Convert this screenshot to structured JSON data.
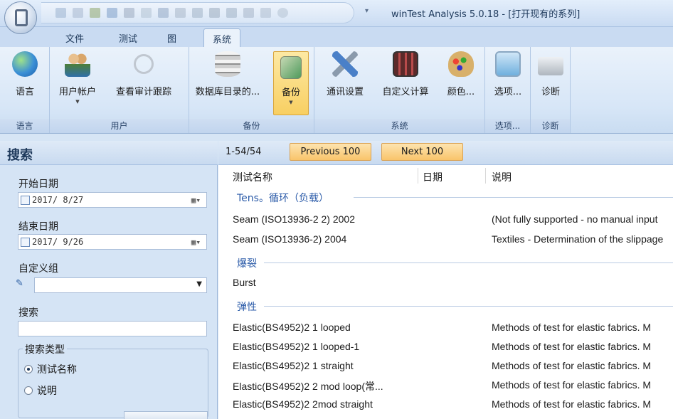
{
  "window": {
    "title": "winTest Analysis 5.0.18 - [打开现有的系列]"
  },
  "tabs": [
    {
      "label": "文件",
      "active": false
    },
    {
      "label": "测试",
      "active": false
    },
    {
      "label": "图",
      "active": false
    },
    {
      "label": "系统",
      "active": true
    }
  ],
  "ribbon": {
    "groups": [
      {
        "label": "语言",
        "buttons": [
          {
            "label": "语言",
            "icon": "globe-icon"
          }
        ]
      },
      {
        "label": "用户",
        "buttons": [
          {
            "label": "用户帐户",
            "icon": "users-icon"
          },
          {
            "label": "查看审计跟踪",
            "icon": "magnifier-icon"
          }
        ]
      },
      {
        "label": "备份",
        "buttons": [
          {
            "label": "数据库目录的...",
            "icon": "database-icon"
          },
          {
            "label": "备份",
            "icon": "backup-icon"
          }
        ]
      },
      {
        "label": "系统",
        "buttons": [
          {
            "label": "通讯设置",
            "icon": "tools-icon"
          },
          {
            "label": "自定义计算",
            "icon": "calculator-icon"
          },
          {
            "label": "颜色...",
            "icon": "palette-icon"
          }
        ]
      },
      {
        "label": "选项...",
        "buttons": [
          {
            "label": "选项...",
            "icon": "options-icon"
          }
        ]
      },
      {
        "label": "诊断",
        "buttons": [
          {
            "label": "诊断",
            "icon": "diagnostics-icon"
          }
        ]
      }
    ]
  },
  "search": {
    "title": "搜索",
    "start_date_label": "开始日期",
    "start_date": "2017/ 8/27",
    "end_date_label": "结束日期",
    "end_date": "2017/ 9/26",
    "custom_group_label": "自定义组",
    "search_label": "搜索",
    "search_value": "",
    "search_type_label": "搜索类型",
    "types": [
      {
        "label": "测试名称",
        "selected": true
      },
      {
        "label": "说明",
        "selected": false
      }
    ]
  },
  "pager": {
    "count": "1-54/54",
    "previous": "Previous 100",
    "next": "Next 100"
  },
  "columns": {
    "name": "测试名称",
    "date": "日期",
    "description": "说明"
  },
  "categories": [
    {
      "name": "Tens。循环（负载）",
      "rows": [
        {
          "name": "Seam (ISO13936-2 2) 2002",
          "desc": "(Not fully supported - no manual input"
        },
        {
          "name": "Seam (ISO13936-2) 2004",
          "desc": "Textiles - Determination of the slippage"
        }
      ]
    },
    {
      "name": "爆裂",
      "rows": [
        {
          "name": "Burst",
          "desc": ""
        }
      ]
    },
    {
      "name": "弹性",
      "rows": [
        {
          "name": "Elastic(BS4952)2 1 looped",
          "desc": "Methods of test for elastic fabrics. M"
        },
        {
          "name": "Elastic(BS4952)2 1 looped-1",
          "desc": "Methods of test for elastic fabrics. M"
        },
        {
          "name": "Elastic(BS4952)2 1 straight",
          "desc": "Methods of test for elastic fabrics. M"
        },
        {
          "name": "Elastic(BS4952)2 2 mod loop(常...",
          "desc": "Methods of test for elastic fabrics. M"
        },
        {
          "name": "Elastic(BS4952)2 2mod straight",
          "desc": "Methods of test for elastic fabrics. M"
        }
      ]
    }
  ]
}
